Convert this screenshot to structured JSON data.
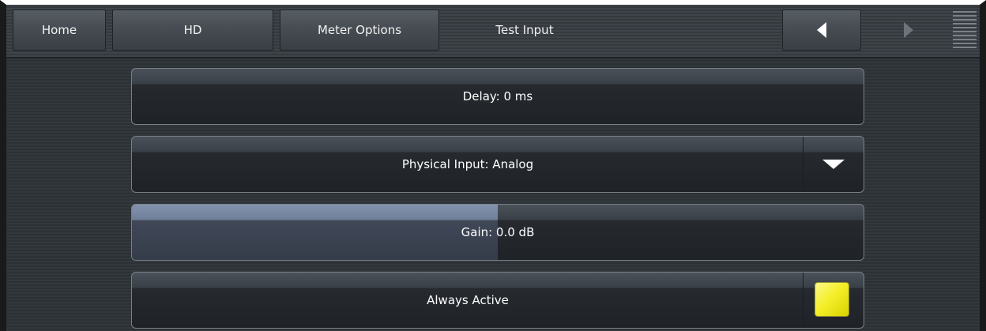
{
  "nav": {
    "home_label": "Home",
    "hd_label": "HD",
    "meter_options_label": "Meter Options",
    "test_input_label": "Test Input",
    "back_icon": "triangle-left-icon",
    "forward_icon": "triangle-right-icon",
    "menu_icon": "hamburger-lines-icon"
  },
  "settings": {
    "delay_label": "Delay: 0 ms",
    "physical_input_label": "Physical Input: Analog",
    "dropdown_icon": "triangle-down-icon",
    "gain_label": "Gain: 0.0 dB",
    "gain_level_fraction": 0.5,
    "always_active_label": "Always Active",
    "always_active_checked": true
  },
  "colors": {
    "checkbox_on": "#f4ef2a",
    "slider_fill": "#7a89a3"
  }
}
